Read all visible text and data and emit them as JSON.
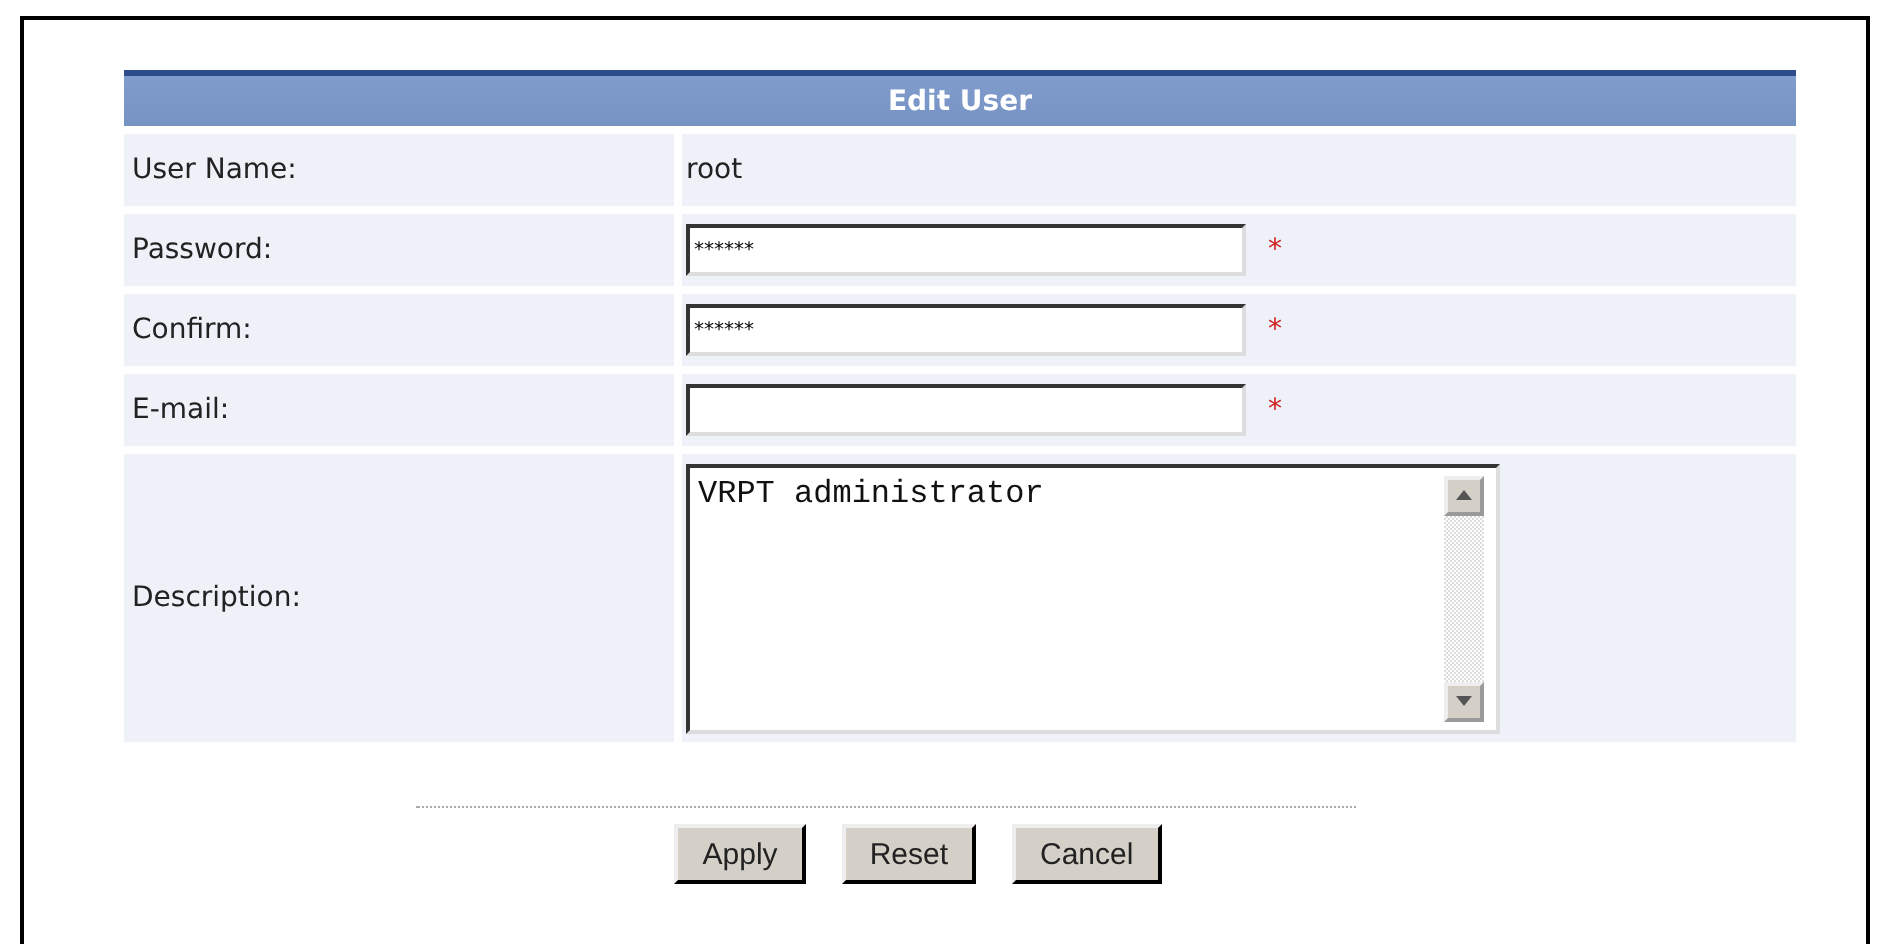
{
  "form": {
    "title": "Edit User",
    "rows": [
      {
        "kind": "static",
        "label": "User Name:",
        "value": "root"
      },
      {
        "kind": "input",
        "label": "Password:",
        "value": "******",
        "required_mark": "*"
      },
      {
        "kind": "input",
        "label": "Confirm:",
        "value": "******",
        "required_mark": "*"
      },
      {
        "kind": "input",
        "label": "E-mail:",
        "value": "",
        "required_mark": "*"
      },
      {
        "kind": "textarea",
        "label": "Description:",
        "value": "VRPT administrator"
      }
    ]
  },
  "buttons": [
    "Apply",
    "Reset",
    "Cancel"
  ]
}
